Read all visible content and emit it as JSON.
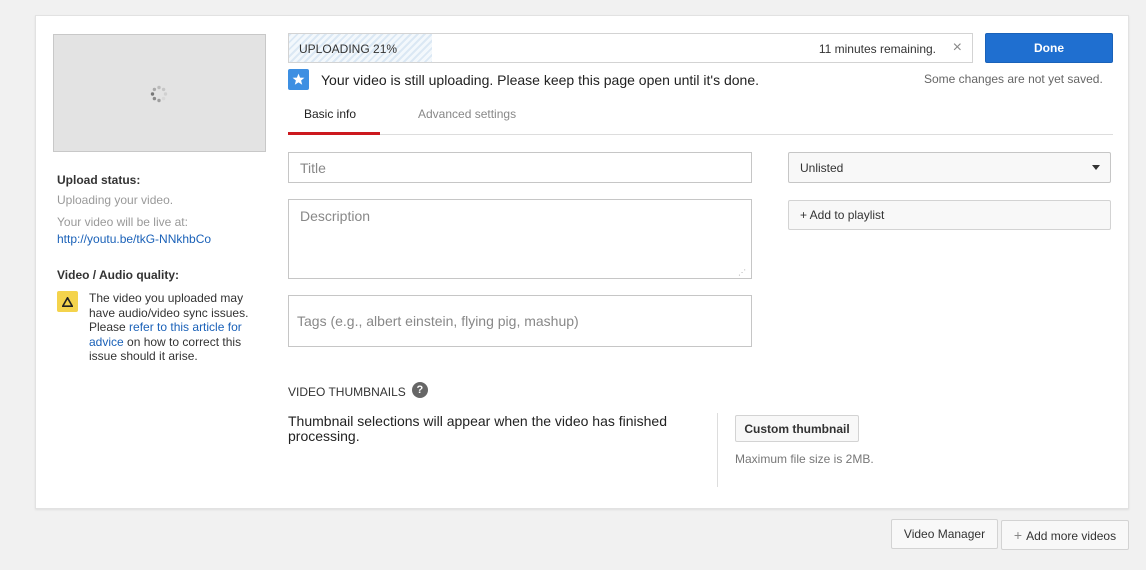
{
  "colors": {
    "primary": "#1f6fd0",
    "accent_tab": "#cc181e",
    "warning": "#f4d34c",
    "notice": "#3d8fe2",
    "link": "#1a61b8"
  },
  "upload": {
    "progress_label": "UPLOADING 21%",
    "progress_fraction": 0.21,
    "remaining": "11 minutes remaining.",
    "close_glyph": "×",
    "done_label": "Done",
    "unsaved_note": "Some changes are not yet saved.",
    "notice": "Your video is still uploading. Please keep this page open until it's done.",
    "notice_icon": "star-icon"
  },
  "sidebar": {
    "status_label": "Upload status:",
    "status_text": "Uploading your video.",
    "live_text": "Your video will be live at:",
    "video_url": "http://youtu.be/tkG-NNkhbCo",
    "quality_label": "Video / Audio quality:",
    "warning_icon": "warning-icon",
    "warning_before": "The video you uploaded may have audio/video sync issues. Please ",
    "warning_link": "refer to this article for advice",
    "warning_after": " on how to correct this issue should it arise."
  },
  "tabs": [
    {
      "label": "Basic info",
      "active": true
    },
    {
      "label": "Advanced settings",
      "active": false
    }
  ],
  "form": {
    "title_placeholder": "Title",
    "title_value": "",
    "description_placeholder": "Description",
    "description_value": "",
    "tags_placeholder": "Tags (e.g., albert einstein, flying pig, mashup)",
    "tags_value": "",
    "privacy_selected": "Unlisted",
    "add_playlist_label": "+ Add to playlist"
  },
  "thumbnails": {
    "heading": "VIDEO THUMBNAILS",
    "help_glyph": "?",
    "message": "Thumbnail selections will appear when the video has finished processing.",
    "custom_button": "Custom thumbnail",
    "max_size": "Maximum file size is 2MB."
  },
  "footer": {
    "video_manager": "Video Manager",
    "add_more_plus": "+",
    "add_more": "Add more videos"
  }
}
